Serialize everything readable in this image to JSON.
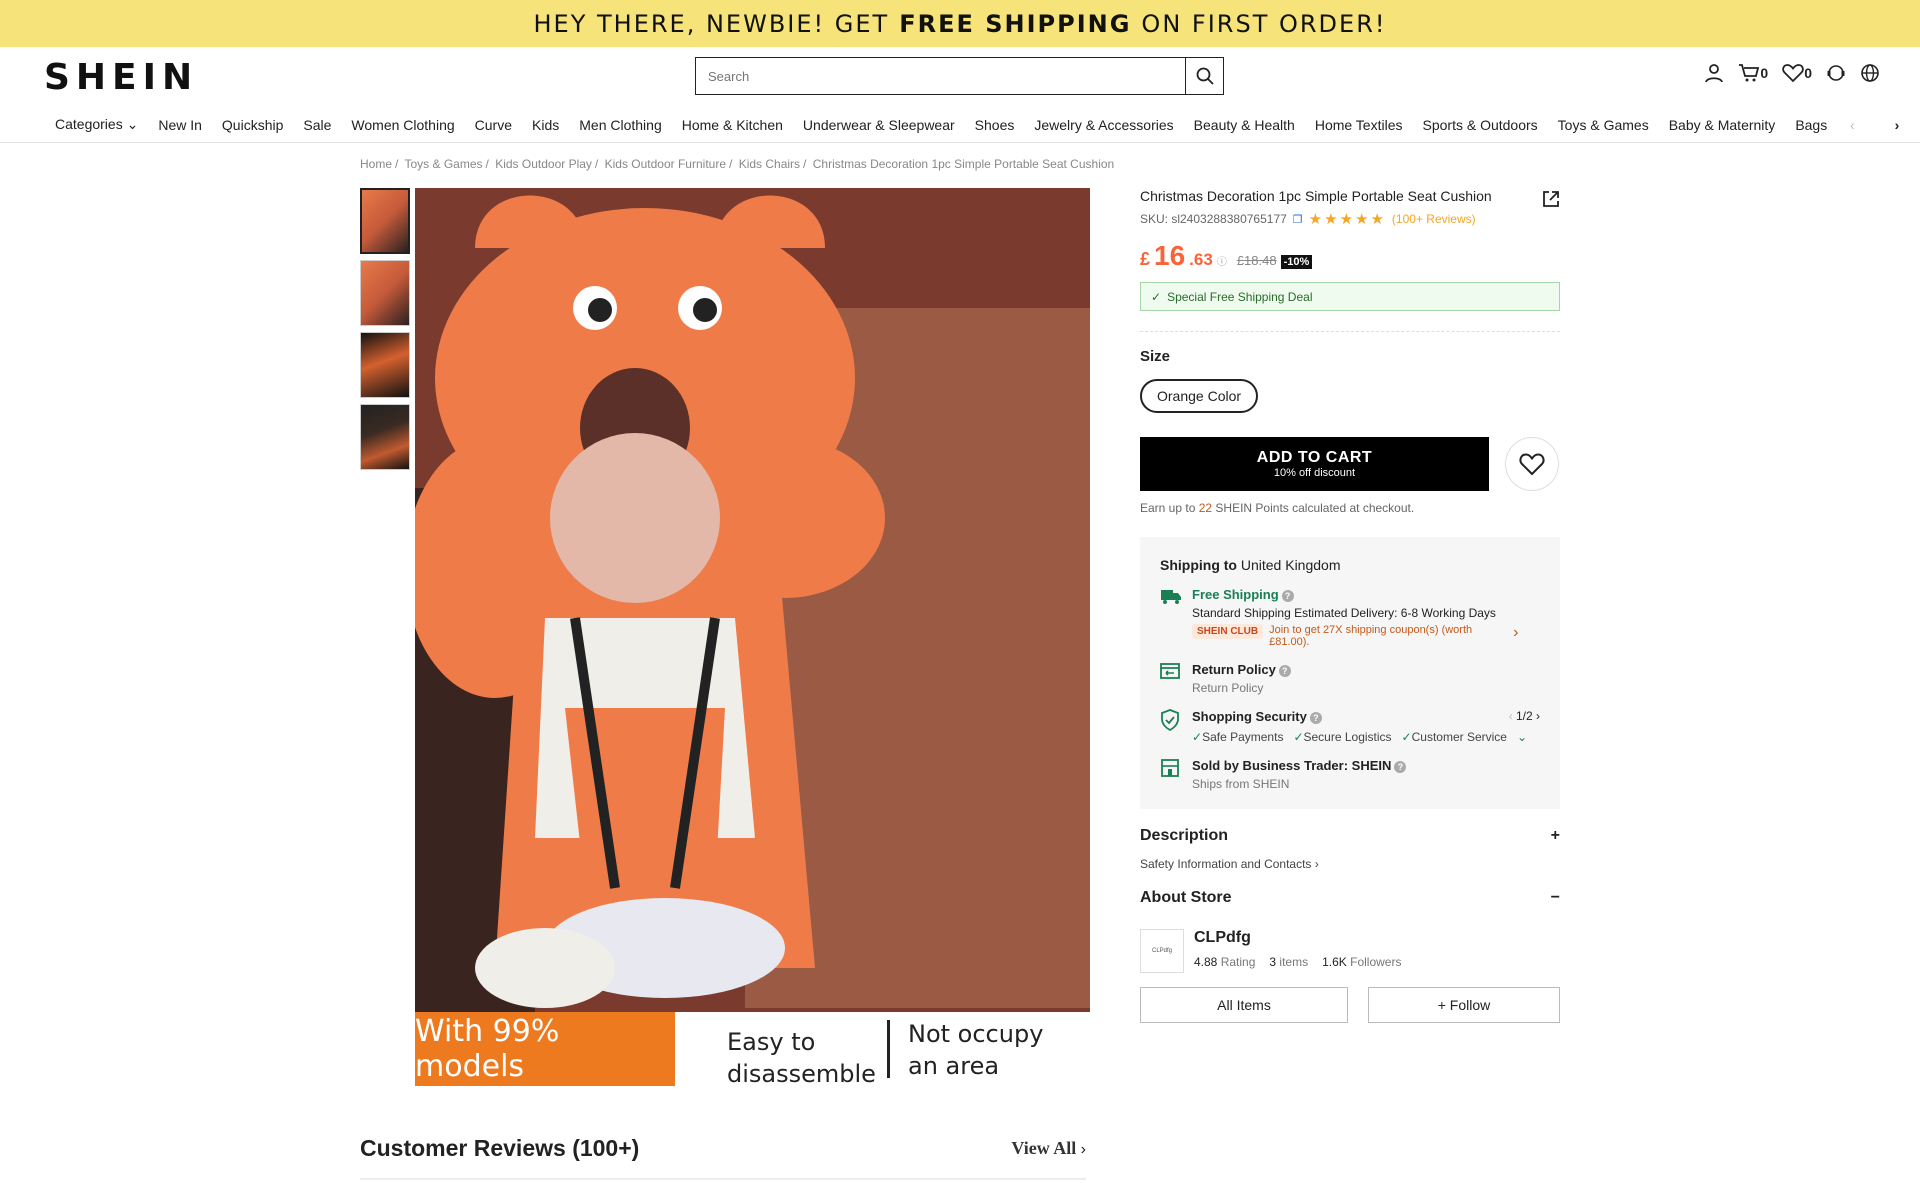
{
  "promo": {
    "pre": "HEY THERE, NEWBIE! GET",
    "bold": "FREE SHIPPING",
    "post": "ON FIRST ORDER!"
  },
  "header": {
    "logo": "SHEIN",
    "search_placeholder": "Search",
    "cart_count": "0",
    "wish_count": "0"
  },
  "nav": [
    "Categories",
    "New In",
    "Quickship",
    "Sale",
    "Women Clothing",
    "Curve",
    "Kids",
    "Men Clothing",
    "Home & Kitchen",
    "Underwear & Sleepwear",
    "Shoes",
    "Jewelry & Accessories",
    "Beauty & Health",
    "Home Textiles",
    "Sports & Outdoors",
    "Toys & Games",
    "Baby & Maternity",
    "Bags & Luggage"
  ],
  "breadcrumb": [
    "Home",
    "Toys & Games",
    "Kids Outdoor Play",
    "Kids Outdoor Furniture",
    "Kids Chairs",
    "Christmas Decoration 1pc Simple Portable Seat Cushion"
  ],
  "image_strip": {
    "s1": "With 99% models",
    "s2a": "Easy to",
    "s2b": "disassemble",
    "s3a": "Not occupy",
    "s3b": "an area"
  },
  "product": {
    "title": "Christmas Decoration 1pc Simple Portable Seat Cushion",
    "sku": "SKU: sl2403288380765177",
    "rating_stars": 4.5,
    "reviews_count": "(100+ Reviews)",
    "price_currency": "£",
    "price_main": "16",
    "price_decimal": ".63",
    "price_old": "£18.48",
    "discount": "-10%",
    "ship_deal": "Special Free Shipping Deal",
    "size_label": "Size",
    "size_option": "Orange Color",
    "atc_label": "ADD TO CART",
    "atc_sub": "10% off discount",
    "points_pre": "Earn up to",
    "points_num": "22",
    "points_post": "SHEIN Points calculated at checkout."
  },
  "shipping": {
    "to_label": "Shipping to",
    "country": "United Kingdom",
    "free_title": "Free Shipping",
    "free_desc": "Standard Shipping Estimated Delivery: 6-8 Working Days",
    "club_badge": "SHEIN CLUB",
    "club_text": "Join to get 27X shipping coupon(s) (worth £81.00).",
    "return_title": "Return Policy",
    "return_desc": "Return Policy",
    "security_title": "Shopping Security",
    "security_page": "1/2",
    "security_items": [
      "Safe Payments",
      "Secure Logistics",
      "Customer Service"
    ],
    "sold_title": "Sold by Business Trader: SHEIN",
    "sold_desc": "Ships from SHEIN"
  },
  "description": {
    "label": "Description",
    "toggle": "+",
    "safety": "Safety Information and Contacts"
  },
  "store": {
    "label": "About Store",
    "toggle": "−",
    "logo_text": "CLPdfg",
    "name": "CLPdfg",
    "rating": "4.88",
    "rating_label": "Rating",
    "items": "3",
    "items_label": "items",
    "followers": "1.6K",
    "followers_label": "Followers",
    "all_items": "All Items",
    "follow": "+ Follow"
  },
  "reviews": {
    "title": "Customer Reviews (100+)",
    "view_all": "View All"
  }
}
